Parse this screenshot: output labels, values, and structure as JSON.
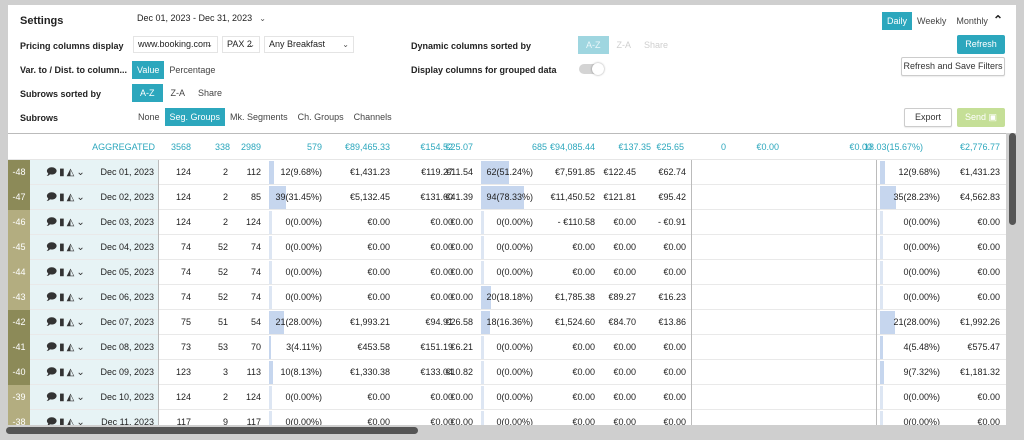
{
  "settings": {
    "title": "Settings",
    "date_range": "Dec 01, 2023 - Dec 31, 2023",
    "collapse_icon": "chevron-up-icon"
  },
  "granularity": {
    "options": [
      "Daily",
      "Weekly",
      "Monthly"
    ],
    "selected": "Daily"
  },
  "pricing": {
    "label": "Pricing columns display",
    "source": "www.booking.com",
    "pax": "PAX 2",
    "meal": "Any Breakfast"
  },
  "var_dist": {
    "label": "Var. to / Dist. to column...",
    "options": [
      "Value",
      "Percentage"
    ],
    "selected": "Value"
  },
  "subrows_sorted": {
    "label": "Subrows sorted by",
    "options": [
      "A-Z",
      "Z-A",
      "Share"
    ],
    "selected": "A-Z"
  },
  "subrows": {
    "label": "Subrows",
    "options": [
      "None",
      "Seg. Groups",
      "Mk. Segments",
      "Ch. Groups",
      "Channels"
    ],
    "selected": "Seg. Groups"
  },
  "dynamic_sorted": {
    "label": "Dynamic columns sorted by",
    "options": [
      "A-Z",
      "Z-A",
      "Share"
    ],
    "selected": "A-Z"
  },
  "display_grouped": {
    "label": "Display columns for grouped data",
    "enabled": false
  },
  "buttons": {
    "refresh": "Refresh",
    "refresh_save": "Refresh and Save Filters",
    "export": "Export",
    "send": "Send"
  },
  "colors": {
    "accent": "#2ca7bd",
    "offset_dark": "#8c8a58",
    "offset_light": "#b3ad80",
    "bar": "#c6d6ee"
  },
  "aggregated": {
    "label": "AGGREGATED",
    "values": [
      "3568",
      "338",
      "2989",
      "579",
      "€89,465.33",
      "€154.52",
      "€25.07",
      "685",
      "€94,085.44",
      "€137.35",
      "€25.65",
      "0",
      "€0.00",
      "€0.00",
      "18.03(15.67%)",
      "€2,776.77"
    ]
  },
  "rows": [
    {
      "offset": "-48",
      "date": "Dec 01, 2023",
      "a": "124",
      "b": "2",
      "c": "112",
      "d": "12(9.68%)",
      "e": "€1,431.23",
      "f": "€119.27",
      "g": "€11.54",
      "h": "62(51.24%)",
      "i": "€7,591.85",
      "j": "€122.45",
      "k": "€62.74",
      "l": "",
      "m": "",
      "n": "12(9.68%)",
      "o": "€1,431.23",
      "d_pct": 9.68,
      "h_pct": 51.24,
      "n_pct": 9.68
    },
    {
      "offset": "-47",
      "date": "Dec 02, 2023",
      "a": "124",
      "b": "2",
      "c": "85",
      "d": "39(31.45%)",
      "e": "€5,132.45",
      "f": "€131.60",
      "g": "€41.39",
      "h": "94(78.33%)",
      "i": "€11,450.52",
      "j": "€121.81",
      "k": "€95.42",
      "l": "",
      "m": "",
      "n": "35(28.23%)",
      "o": "€4,562.83",
      "d_pct": 31.45,
      "h_pct": 78.33,
      "n_pct": 28.23
    },
    {
      "offset": "-46",
      "date": "Dec 03, 2023",
      "a": "124",
      "b": "2",
      "c": "124",
      "d": "0(0.00%)",
      "e": "€0.00",
      "f": "€0.00",
      "g": "€0.00",
      "h": "0(0.00%)",
      "i": "- €110.58",
      "j": "€0.00",
      "k": "- €0.91",
      "l": "",
      "m": "",
      "n": "0(0.00%)",
      "o": "€0.00",
      "d_pct": 0,
      "h_pct": 0,
      "n_pct": 0
    },
    {
      "offset": "-45",
      "date": "Dec 04, 2023",
      "a": "74",
      "b": "52",
      "c": "74",
      "d": "0(0.00%)",
      "e": "€0.00",
      "f": "€0.00",
      "g": "€0.00",
      "h": "0(0.00%)",
      "i": "€0.00",
      "j": "€0.00",
      "k": "€0.00",
      "l": "",
      "m": "",
      "n": "0(0.00%)",
      "o": "€0.00",
      "d_pct": 0,
      "h_pct": 0,
      "n_pct": 0
    },
    {
      "offset": "-44",
      "date": "Dec 05, 2023",
      "a": "74",
      "b": "52",
      "c": "74",
      "d": "0(0.00%)",
      "e": "€0.00",
      "f": "€0.00",
      "g": "€0.00",
      "h": "0(0.00%)",
      "i": "€0.00",
      "j": "€0.00",
      "k": "€0.00",
      "l": "",
      "m": "",
      "n": "0(0.00%)",
      "o": "€0.00",
      "d_pct": 0,
      "h_pct": 0,
      "n_pct": 0
    },
    {
      "offset": "-43",
      "date": "Dec 06, 2023",
      "a": "74",
      "b": "52",
      "c": "74",
      "d": "0(0.00%)",
      "e": "€0.00",
      "f": "€0.00",
      "g": "€0.00",
      "h": "20(18.18%)",
      "i": "€1,785.38",
      "j": "€89.27",
      "k": "€16.23",
      "l": "",
      "m": "",
      "n": "0(0.00%)",
      "o": "€0.00",
      "d_pct": 0,
      "h_pct": 18.18,
      "n_pct": 0
    },
    {
      "offset": "-42",
      "date": "Dec 07, 2023",
      "a": "75",
      "b": "51",
      "c": "54",
      "d": "21(28.00%)",
      "e": "€1,993.21",
      "f": "€94.91",
      "g": "€26.58",
      "h": "18(16.36%)",
      "i": "€1,524.60",
      "j": "€84.70",
      "k": "€13.86",
      "l": "",
      "m": "",
      "n": "21(28.00%)",
      "o": "€1,992.26",
      "d_pct": 28,
      "h_pct": 16.36,
      "n_pct": 28
    },
    {
      "offset": "-41",
      "date": "Dec 08, 2023",
      "a": "73",
      "b": "53",
      "c": "70",
      "d": "3(4.11%)",
      "e": "€453.58",
      "f": "€151.19",
      "g": "€6.21",
      "h": "0(0.00%)",
      "i": "€0.00",
      "j": "€0.00",
      "k": "€0.00",
      "l": "",
      "m": "",
      "n": "4(5.48%)",
      "o": "€575.47",
      "d_pct": 4.11,
      "h_pct": 0,
      "n_pct": 5.48
    },
    {
      "offset": "-40",
      "date": "Dec 09, 2023",
      "a": "123",
      "b": "3",
      "c": "113",
      "d": "10(8.13%)",
      "e": "€1,330.38",
      "f": "€133.04",
      "g": "€10.82",
      "h": "0(0.00%)",
      "i": "€0.00",
      "j": "€0.00",
      "k": "€0.00",
      "l": "",
      "m": "",
      "n": "9(7.32%)",
      "o": "€1,181.32",
      "d_pct": 8.13,
      "h_pct": 0,
      "n_pct": 7.32
    },
    {
      "offset": "-39",
      "date": "Dec 10, 2023",
      "a": "124",
      "b": "2",
      "c": "124",
      "d": "0(0.00%)",
      "e": "€0.00",
      "f": "€0.00",
      "g": "€0.00",
      "h": "0(0.00%)",
      "i": "€0.00",
      "j": "€0.00",
      "k": "€0.00",
      "l": "",
      "m": "",
      "n": "0(0.00%)",
      "o": "€0.00",
      "d_pct": 0,
      "h_pct": 0,
      "n_pct": 0
    },
    {
      "offset": "-38",
      "date": "Dec 11, 2023",
      "a": "117",
      "b": "9",
      "c": "117",
      "d": "0(0.00%)",
      "e": "€0.00",
      "f": "€0.00",
      "g": "€0.00",
      "h": "0(0.00%)",
      "i": "€0.00",
      "j": "€0.00",
      "k": "€0.00",
      "l": "",
      "m": "",
      "n": "0(0.00%)",
      "o": "€0.00",
      "d_pct": 0,
      "h_pct": 0,
      "n_pct": 0
    }
  ]
}
